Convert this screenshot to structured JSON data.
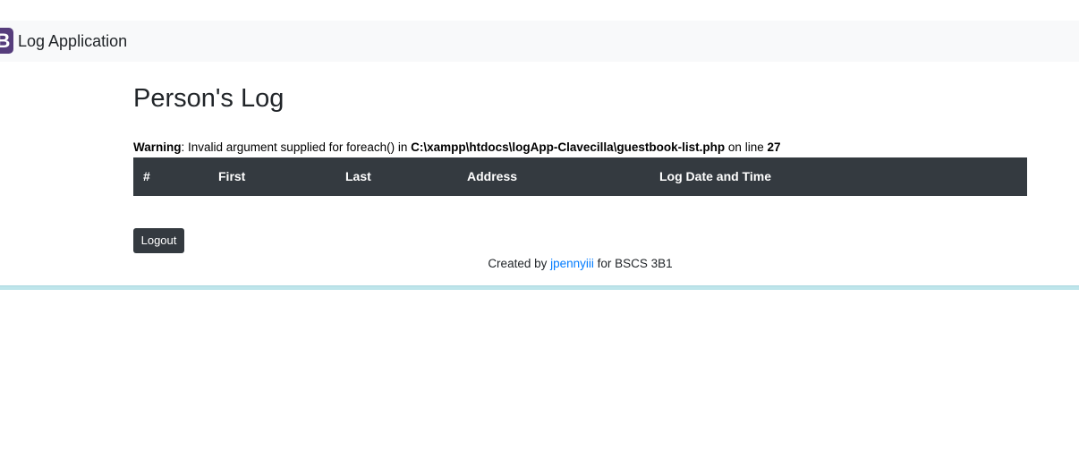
{
  "navbar": {
    "logo_letter": "B",
    "brand": "Log Application"
  },
  "page_title": "Person's Log",
  "warning": {
    "label": "Warning",
    "message": ": Invalid argument supplied for foreach() in ",
    "path": "C:\\xampp\\htdocs\\logApp-Clavecilla\\guestbook-list.php",
    "line_text": " on line ",
    "line_number": "27"
  },
  "table": {
    "columns": [
      "#",
      "First",
      "Last",
      "Address",
      "Log Date and Time"
    ],
    "rows": []
  },
  "logout_label": "Logout",
  "footer": {
    "prefix": "Created by ",
    "author": "jpennyiii",
    "suffix": " for BSCS 3B1"
  },
  "colors": {
    "navbar_bg": "#f8f9fa",
    "brand_logo": "#563d7c",
    "dark": "#343a40",
    "link": "#007bff",
    "footer_line": "#bee5eb"
  }
}
